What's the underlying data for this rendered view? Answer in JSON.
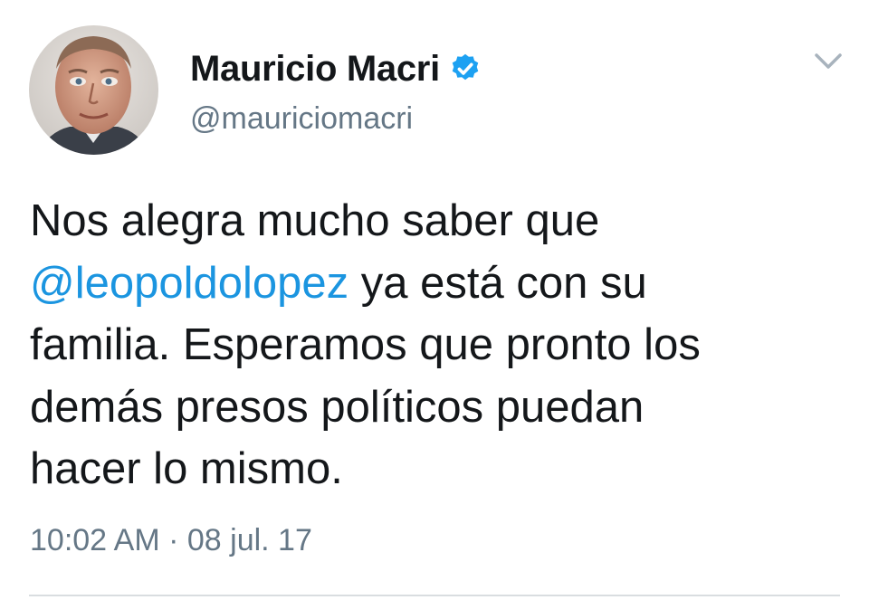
{
  "user": {
    "display_name": "Mauricio Macri",
    "handle": "@mauriciomacri"
  },
  "tweet": {
    "line1": "Nos alegra mucho saber que",
    "mention": "@leopoldolopez",
    "line2_rest": " ya está con su",
    "line3": "familia. Esperamos que pronto los",
    "line4": "demás presos políticos puedan",
    "line5": "hacer lo mismo."
  },
  "meta": {
    "time": "10:02 AM",
    "separator": " · ",
    "date": "08 jul. 17"
  },
  "icons": {
    "verified": "verified-badge-icon",
    "menu": "chevron-down-icon"
  },
  "colors": {
    "link": "#1b95e0",
    "verified": "#1da1f2",
    "secondary_text": "#657786"
  }
}
